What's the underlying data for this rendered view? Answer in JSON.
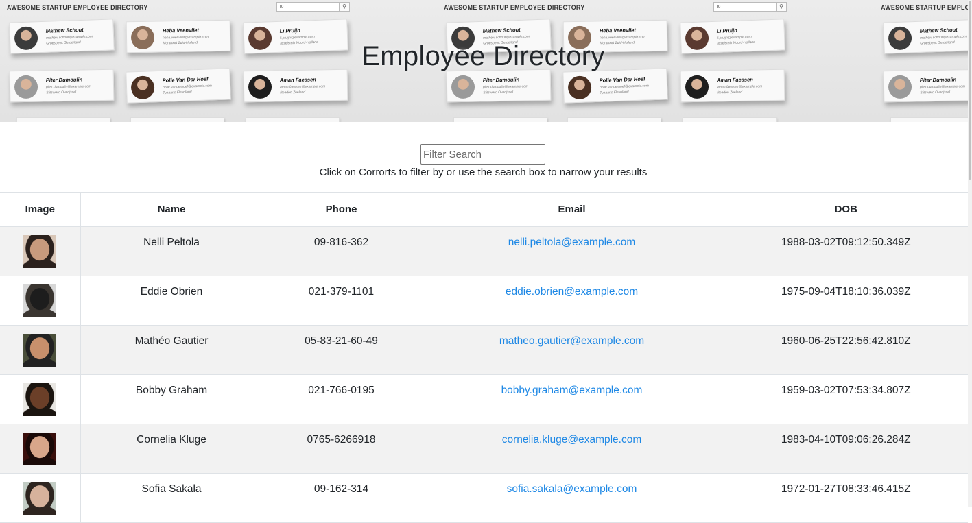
{
  "banner": {
    "title": "Employee Directory",
    "panel_title": "AWESOME STARTUP EMPLOYEE DIRECTORY",
    "panel_search_value": "ro",
    "cards": [
      {
        "name": "Mathew Schout",
        "email": "mathew.schout@example.com",
        "location": "Groesbeek Gelderland"
      },
      {
        "name": "Heba Veenvliet",
        "email": "heba.veenvliet@example.com",
        "location": "Montfoort Zuid-Holland"
      },
      {
        "name": "Li Pruijn",
        "email": "li.pruijn@example.com",
        "location": "Ijsselstein Noord-Holland"
      },
      {
        "name": "Piter Dumoulin",
        "email": "piter.dumoulin@example.com",
        "location": "Stitswerd Overijssel"
      },
      {
        "name": "Polle Van Der Hoef",
        "email": "polle.vanderhoef@example.com",
        "location": "Tynaarlo Flevoland"
      },
      {
        "name": "Aman Faessen",
        "email": "aman.faessen@example.com",
        "location": "Rheden Zeeland"
      }
    ]
  },
  "search": {
    "placeholder": "Filter Search",
    "value": "",
    "instructions": "Click on Corrorts to filter by or use the search box to narrow your results"
  },
  "table": {
    "columns": [
      "Image",
      "Name",
      "Phone",
      "Email",
      "DOB"
    ],
    "rows": [
      {
        "name": "Nelli Peltola",
        "phone": "09-816-362",
        "email": "nelli.peltola@example.com",
        "dob": "1988-03-02T09:12:50.349Z",
        "photo_colors": [
          "#d9c7b8",
          "#2b211d",
          "#c89a7d"
        ]
      },
      {
        "name": "Eddie Obrien",
        "phone": "021-379-1101",
        "email": "eddie.obrien@example.com",
        "dob": "1975-09-04T18:10:36.039Z",
        "photo_colors": [
          "#d7d7d7",
          "#3a3530",
          "#1d1d1d"
        ]
      },
      {
        "name": "Mathéo Gautier",
        "phone": "05-83-21-60-49",
        "email": "matheo.gautier@example.com",
        "dob": "1960-06-25T22:56:42.810Z",
        "photo_colors": [
          "#4a4f3a",
          "#222222",
          "#c8906c"
        ]
      },
      {
        "name": "Bobby Graham",
        "phone": "021-766-0195",
        "email": "bobby.graham@example.com",
        "dob": "1959-03-02T07:53:34.807Z",
        "photo_colors": [
          "#e8e6e2",
          "#1b1510",
          "#6b3f28"
        ]
      },
      {
        "name": "Cornelia Kluge",
        "phone": "0765-6266918",
        "email": "cornelia.kluge@example.com",
        "dob": "1983-04-10T09:06:26.284Z",
        "photo_colors": [
          "#3a0f0c",
          "#1a0a08",
          "#d8a68a"
        ]
      },
      {
        "name": "Sofia Sakala",
        "phone": "09-162-314",
        "email": "sofia.sakala@example.com",
        "dob": "1972-01-27T08:33:46.415Z",
        "photo_colors": [
          "#c2ccc4",
          "#2e2520",
          "#d6b29c"
        ]
      }
    ]
  },
  "colors": {
    "link": "#1e88e5",
    "stripe": "#f2f2f2",
    "border": "#dee2e6"
  }
}
